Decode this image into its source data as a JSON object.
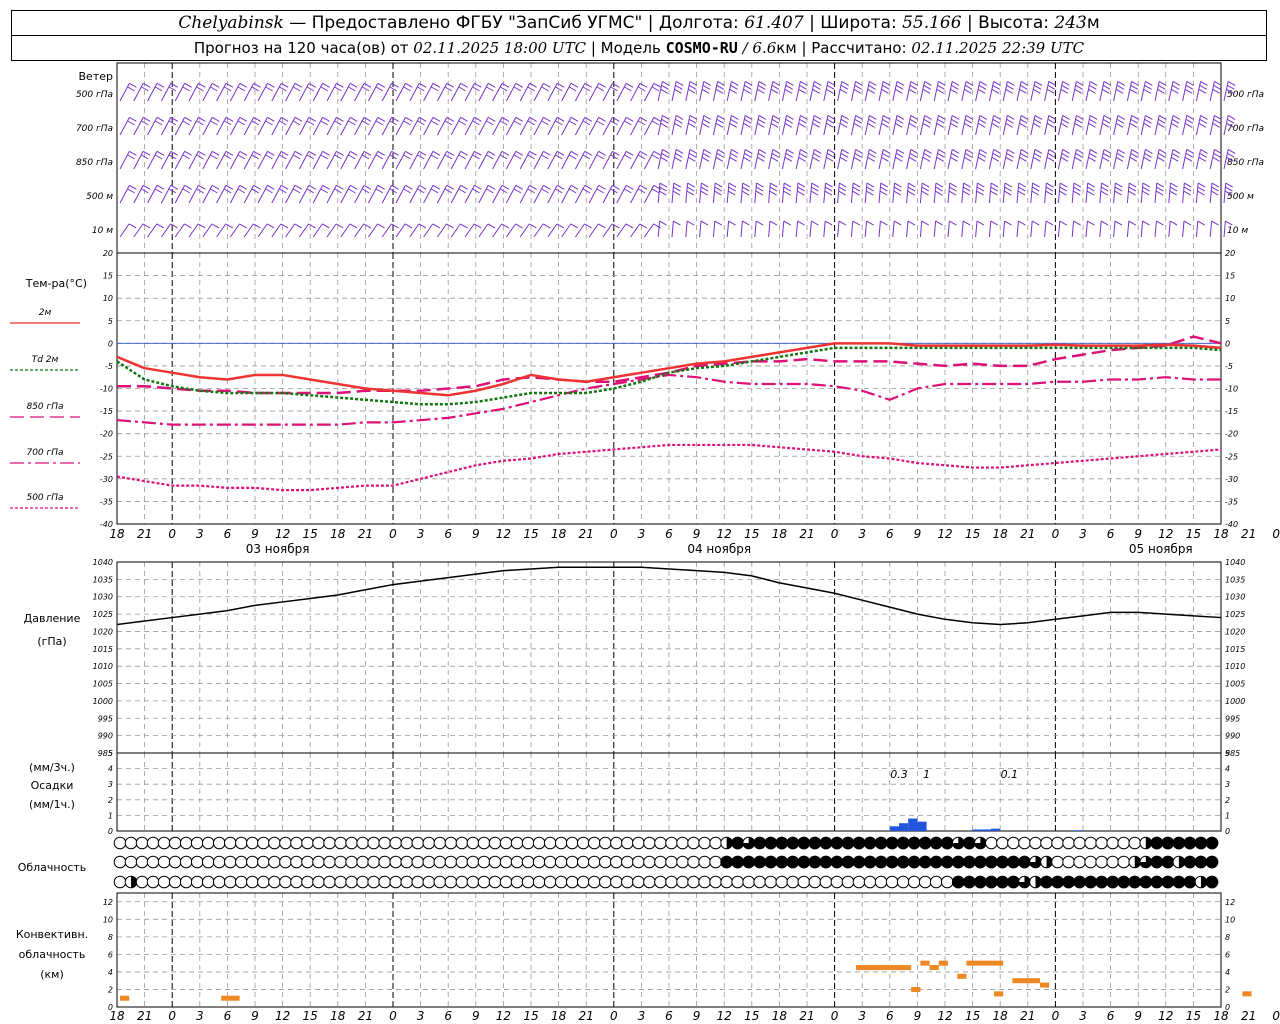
{
  "header": {
    "station": "Chelyabinsk",
    "provider": " — Предоставлено ФГБУ \"ЗапСиб УГМС\" | ",
    "lon_label": "Долгота: ",
    "lon_value": "61.407",
    "lat_label": " | Широта: ",
    "lat_value": "55.166",
    "alt_label": " | Высота: ",
    "alt_value": "243",
    "alt_unit": "м",
    "forecast_label": "Прогноз на 120 часа(ов) от ",
    "forecast_start": "02.11.2025 18:00 UTC",
    "model_label": "  | Модель ",
    "model_name": "COSMO-RU",
    "model_res": " / 6.6",
    "model_res_unit": "км",
    "calc_label": " | Рассчитано: ",
    "calc_time": "02.11.2025 22:39 UTC"
  },
  "labels": {
    "wind_title": "Ветер",
    "wind_levels": [
      "500 гПа",
      "700 гПа",
      "850 гПа",
      "500 м",
      "10  м"
    ],
    "temp_title": "Тем-ра(°C)",
    "temp_legend": [
      "2м",
      "Td  2м",
      "850 гПа",
      "700 гПа",
      "500 гПа"
    ],
    "pressure_title": "Давление",
    "pressure_unit": "(гПа)",
    "precip_units_top": "(мм/3ч.)",
    "precip_title": "Осадки",
    "precip_units_bottom": "(мм/1ч.)",
    "cloud_title": "Облачность",
    "conv_title": [
      "Конвективн.",
      "облачность",
      "(км)"
    ],
    "day_labels": [
      "03 ноября",
      "04 ноября",
      "05 ноября"
    ]
  },
  "colors": {
    "t2m": "#ee3333",
    "td2m": "#117711",
    "t850": "#dd1177",
    "t700": "#dd1177",
    "t500": "#dd1177",
    "zero_line": "#3355cc",
    "wind": "#7733cc",
    "pressure": "#000000",
    "precip": "#2255dd",
    "convective": "#ee8822"
  },
  "chart_data": [
    {
      "type": "barbs",
      "title": "Ветер",
      "levels": [
        "500 гПа",
        "700 гПа",
        "850 гПа",
        "500 м",
        "10  м"
      ],
      "x_ticks": [
        "18",
        "21",
        "0",
        "3",
        "6",
        "9",
        "12",
        "15",
        "18",
        "21",
        "0",
        "3",
        "6",
        "9",
        "12",
        "15",
        "18",
        "21",
        "0",
        "3",
        "6",
        "9",
        "12",
        "15",
        "18",
        "21",
        "0",
        "3",
        "6",
        "9",
        "12",
        "15",
        "18",
        "21",
        "0",
        "3",
        "6",
        "9",
        "12",
        "15",
        "18",
        "21",
        "0"
      ]
    },
    {
      "type": "line",
      "title": "Тем-ра(°C)",
      "x_hours": [
        0,
        3,
        6,
        9,
        12,
        15,
        18,
        21,
        24,
        27,
        30,
        33,
        36,
        39,
        42,
        45,
        48,
        51,
        54,
        57,
        60,
        63,
        66,
        69,
        72,
        75,
        78,
        81,
        84,
        87,
        90,
        93,
        96,
        99,
        102,
        105,
        108,
        111,
        114,
        117,
        120
      ],
      "x_tick_labels": [
        "18",
        "21",
        "0",
        "3",
        "6",
        "9",
        "12",
        "15",
        "18",
        "21",
        "0",
        "3",
        "6",
        "9",
        "12",
        "15",
        "18",
        "21",
        "0",
        "3",
        "6",
        "9",
        "12",
        "15",
        "18",
        "21",
        "0",
        "3",
        "6",
        "9",
        "12",
        "15",
        "18",
        "21",
        "0",
        "3",
        "6",
        "9",
        "12",
        "15",
        "18",
        "21",
        "0"
      ],
      "ylim": [
        -40,
        20
      ],
      "y_ticks": [
        20,
        15,
        10,
        5,
        0,
        -5,
        -10,
        -15,
        -20,
        -25,
        -30,
        -35,
        -40
      ],
      "series": [
        {
          "name": "2м",
          "values": [
            -3,
            -5.5,
            -6.5,
            -7.5,
            -8,
            -7,
            -7,
            -8,
            -9,
            -10,
            -10.5,
            -11,
            -11.5,
            -10.5,
            -9,
            -7,
            -8,
            -8.5,
            -7.5,
            -6.5,
            -5.5,
            -4.5,
            -4,
            -3,
            -2,
            -1,
            0,
            0,
            0,
            -0.5,
            -0.5,
            -0.5,
            -0.5,
            -0.5,
            -0.3,
            -0.5,
            -0.5,
            -0.5,
            -0.3,
            -0.5,
            -1
          ]
        },
        {
          "name": "Td  2м",
          "values": [
            -4,
            -8,
            -9.5,
            -10.5,
            -11,
            -11,
            -11,
            -11.5,
            -12,
            -12.5,
            -13,
            -13.5,
            -13.5,
            -13,
            -12,
            -11,
            -11,
            -11,
            -10,
            -8.5,
            -6.5,
            -5.5,
            -5,
            -4,
            -3,
            -2,
            -1,
            -1,
            -1,
            -1,
            -1,
            -1,
            -1,
            -1,
            -1,
            -1,
            -1,
            -1,
            -1,
            -1,
            -1.5
          ]
        },
        {
          "name": "850 гПа",
          "values": [
            -9.5,
            -9.5,
            -10,
            -10.5,
            -10.5,
            -11,
            -11,
            -11,
            -11,
            -10.5,
            -10.5,
            -10.5,
            -10,
            -9.5,
            -8,
            -7.5,
            -8,
            -8.5,
            -8.5,
            -7.5,
            -6.5,
            -5,
            -4.5,
            -4,
            -4,
            -3.5,
            -4,
            -4,
            -4,
            -4.5,
            -5,
            -4.5,
            -5,
            -5,
            -3.5,
            -2.5,
            -1.5,
            -1,
            -0.5,
            1.5,
            0
          ]
        },
        {
          "name": "700 гПа",
          "values": [
            -17,
            -17.5,
            -18,
            -18,
            -18,
            -18,
            -18,
            -18,
            -18,
            -17.5,
            -17.5,
            -17,
            -16.5,
            -15.5,
            -14.5,
            -13,
            -11.5,
            -10,
            -9,
            -8,
            -7,
            -7.5,
            -8.5,
            -9,
            -9,
            -9,
            -9.5,
            -10.5,
            -12.5,
            -10,
            -9,
            -9,
            -9,
            -9,
            -8.5,
            -8.5,
            -8,
            -8,
            -7.5,
            -8,
            -8
          ]
        },
        {
          "name": "500 гПа",
          "values": [
            -29.5,
            -30.5,
            -31.5,
            -31.5,
            -32,
            -32,
            -32.5,
            -32.5,
            -32,
            -31.5,
            -31.5,
            -30,
            -28.5,
            -27,
            -26,
            -25.5,
            -24.5,
            -24,
            -23.5,
            -23,
            -22.5,
            -22.5,
            -22.5,
            -22.5,
            -23,
            -23.5,
            -24,
            -25,
            -25.5,
            -26.5,
            -27,
            -27.5,
            -27.5,
            -27,
            -26.5,
            -26,
            -25.5,
            -25,
            -24.5,
            -24,
            -23.5
          ]
        }
      ]
    },
    {
      "type": "line",
      "title": "Давление",
      "ylabel": "(гПа)",
      "ylim": [
        985,
        1040
      ],
      "y_ticks": [
        1040,
        1035,
        1030,
        1025,
        1020,
        1015,
        1010,
        1005,
        1000,
        995,
        990,
        985
      ],
      "x_hours": [
        0,
        3,
        6,
        9,
        12,
        15,
        18,
        21,
        24,
        27,
        30,
        33,
        36,
        39,
        42,
        45,
        48,
        51,
        54,
        57,
        60,
        63,
        66,
        69,
        72,
        75,
        78,
        81,
        84,
        87,
        90,
        93,
        96,
        99,
        102,
        105,
        108,
        111,
        114,
        117,
        120
      ],
      "series": [
        {
          "name": "Давление",
          "values": [
            1022,
            1023,
            1024,
            1025,
            1026,
            1027.5,
            1028.5,
            1029.5,
            1030.5,
            1032,
            1033.5,
            1034.5,
            1035.5,
            1036.5,
            1037.5,
            1038,
            1038.5,
            1038.5,
            1038.5,
            1038.5,
            1038,
            1037.5,
            1037,
            1036,
            1034,
            1032.5,
            1031,
            1029,
            1027,
            1025,
            1023.5,
            1022.5,
            1022,
            1022.5,
            1023.5,
            1024.5,
            1025.5,
            1025.5,
            1025,
            1024.5,
            1024
          ]
        }
      ]
    },
    {
      "type": "bar",
      "title": "Осадки",
      "ylabel": "(мм/3ч.) / (мм/1ч.)",
      "ylim": [
        0,
        5
      ],
      "y_ticks": [
        5,
        4,
        3,
        2,
        1,
        0
      ],
      "bars_hours": [
        [
          84,
          85,
          0.3
        ],
        [
          85,
          86,
          0.5
        ],
        [
          86,
          87,
          0.8
        ],
        [
          87,
          88,
          0.6
        ],
        [
          93,
          94,
          0.1
        ],
        [
          94,
          95,
          0.1
        ],
        [
          95,
          96,
          0.15
        ],
        [
          104,
          105,
          0.05
        ]
      ],
      "annotations": [
        {
          "hour": 85,
          "text": "0.3"
        },
        {
          "hour": 88,
          "text": "1"
        },
        {
          "hour": 97,
          "text": "0.1"
        }
      ]
    },
    {
      "type": "table",
      "title": "Облачность",
      "rows": [
        "0000000000000000000000000000000000000000000000000000000243444444444444444444343000000000000002444444",
        "0000000000000000000000000000000000000000000000000000000444444444444444444444444444432000000023442444",
        "0200000000000000000000000000000000000000000000000000000000000000000000000000444444324444444444444424"
      ]
    },
    {
      "type": "bar",
      "title": "Конвективн. облачность (км)",
      "ylim": [
        0,
        13
      ],
      "y_ticks": [
        12,
        10,
        8,
        6,
        4,
        2,
        0
      ],
      "segments": [
        [
          0,
          1,
          1
        ],
        [
          11,
          13,
          1
        ],
        [
          80,
          83,
          4.5
        ],
        [
          83,
          86,
          4.5
        ],
        [
          86,
          87,
          2
        ],
        [
          87,
          88,
          5
        ],
        [
          88,
          89,
          4.5
        ],
        [
          89,
          90,
          5
        ],
        [
          91,
          92,
          3.5
        ],
        [
          92,
          96,
          5
        ],
        [
          95,
          96,
          1.5
        ],
        [
          97,
          100,
          3
        ],
        [
          100,
          101,
          2.5
        ],
        [
          122,
          123,
          1.5
        ]
      ]
    }
  ]
}
